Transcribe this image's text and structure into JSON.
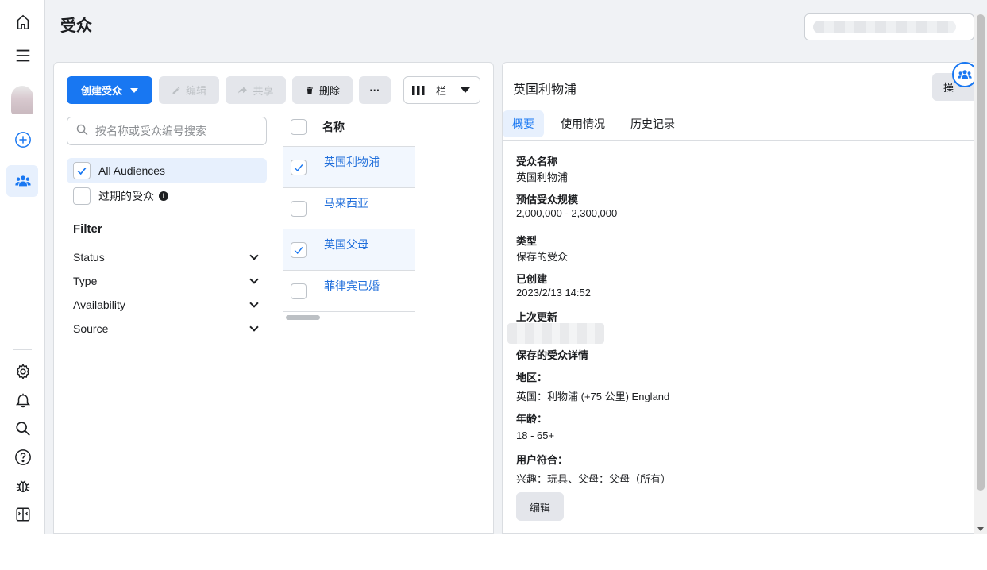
{
  "page": {
    "title": "受众"
  },
  "toolbar": {
    "create_label": "创建受众",
    "edit_label": "编辑",
    "share_label": "共享",
    "delete_label": "删除",
    "more_label": "···",
    "columns_label": "栏"
  },
  "search": {
    "placeholder": "按名称或受众编号搜索"
  },
  "audience_filter": {
    "all_label": "All Audiences",
    "expired_label": "过期的受众"
  },
  "filter": {
    "title": "Filter",
    "items": [
      {
        "label": "Status"
      },
      {
        "label": "Type"
      },
      {
        "label": "Availability"
      },
      {
        "label": "Source"
      }
    ]
  },
  "table": {
    "header": "名称",
    "rows": [
      {
        "name": "英国利物浦",
        "checked": true
      },
      {
        "name": "马来西亚",
        "checked": false
      },
      {
        "name": "英国父母",
        "checked": true
      },
      {
        "name": "菲律宾已婚",
        "checked": false
      }
    ]
  },
  "detail": {
    "title": "英国利物浦",
    "action_label": "操",
    "tabs": [
      {
        "label": "概要"
      },
      {
        "label": "使用情况"
      },
      {
        "label": "历史记录"
      }
    ],
    "fields": {
      "name_label": "受众名称",
      "name_value": "英国利物浦",
      "size_label": "预估受众规模",
      "size_value": "2,000,000 - 2,300,000",
      "type_label": "类型",
      "type_value": "保存的受众",
      "created_label": "已创建",
      "created_value": "2023/2/13 14:52",
      "updated_label": "上次更新",
      "details_label": "保存的受众详情",
      "region_label": "地区：",
      "region_value": "英国：利物浦 (+75 公里) England",
      "age_label": "年龄：",
      "age_value": "18 - 65+",
      "match_label": "用户符合：",
      "match_value": "兴趣：玩具、父母：父母（所有）"
    },
    "edit_label": "编辑"
  },
  "colors": {
    "accent": "#1877f2",
    "link": "#216fdb",
    "selected_bg": "#e7f0fd"
  }
}
